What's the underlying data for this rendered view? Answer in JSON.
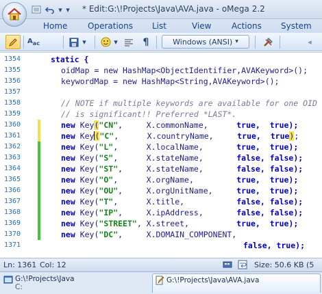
{
  "window": {
    "title": "* Edit:G:\\!Projects\\Java\\AVA.java - oMega 2.2"
  },
  "ribbon_tabs": [
    "Home",
    "Operations",
    "List",
    "View",
    "Actions",
    "System"
  ],
  "toolbar": {
    "encoding_label": "Windows (ANSI)"
  },
  "editor": {
    "lines": [
      {
        "num": "1354",
        "marked": false
      },
      {
        "num": "1355",
        "marked": false
      },
      {
        "num": "1356",
        "marked": false
      },
      {
        "num": "1357",
        "marked": false
      },
      {
        "num": "1358",
        "marked": false
      },
      {
        "num": "1359",
        "marked": false
      },
      {
        "num": "1360",
        "marked": "yellow"
      },
      {
        "num": "1361",
        "marked": "yellow"
      },
      {
        "num": "1362",
        "marked": "green"
      },
      {
        "num": "1363",
        "marked": "green"
      },
      {
        "num": "1364",
        "marked": "green"
      },
      {
        "num": "1365",
        "marked": "green"
      },
      {
        "num": "1366",
        "marked": "green"
      },
      {
        "num": "1367",
        "marked": "green"
      },
      {
        "num": "1368",
        "marked": "green"
      },
      {
        "num": "1369",
        "marked": "green"
      },
      {
        "num": "1370",
        "marked": "green"
      },
      {
        "num": "1371",
        "marked": false
      }
    ],
    "code": {
      "l1354": "static {",
      "l1355": "oidMap = new HashMap<ObjectIdentifier,AVAKeyword>();",
      "l1356": "keywordMap = new HashMap<String,AVAKeyword>();",
      "l1358": "// NOTE if multiple keywords are available for one OID",
      "l1359": "// is significant!! Preferred *LAST*.",
      "keys": [
        {
          "str": "\"CN\"",
          "field": "X.commonName,",
          "b1": "true,",
          "b2": "true);"
        },
        {
          "str": "\"C\"",
          "field": "X.countryName,",
          "b1": "true,",
          "b2": "true);"
        },
        {
          "str": "\"L\"",
          "field": "X.localName,",
          "b1": "true,",
          "b2": "true);"
        },
        {
          "str": "\"S\"",
          "field": "X.stateName,",
          "b1": "false,",
          "b2": "false);"
        },
        {
          "str": "\"ST\"",
          "field": "X.stateName,",
          "b1": "false,",
          "b2": "false);"
        },
        {
          "str": "\"O\"",
          "field": "X.orgName,",
          "b1": "true,",
          "b2": "true);"
        },
        {
          "str": "\"OU\"",
          "field": "X.orgUnitName,",
          "b1": "true,",
          "b2": "true);"
        },
        {
          "str": "\"T\"",
          "field": "X.title,",
          "b1": "false,",
          "b2": "false);"
        },
        {
          "str": "\"IP\"",
          "field": "X.ipAddress,",
          "b1": "false,",
          "b2": "false);"
        },
        {
          "str": "\"STREET\"",
          "field": "X.street,",
          "b1": "true,",
          "b2": "true);"
        },
        {
          "str": "\"DC\"",
          "field": "X.DOMAIN_COMPONENT,",
          "b1": "",
          "b2": ""
        }
      ],
      "l1371": "false, true);"
    }
  },
  "status": {
    "line": "Ln: 1361",
    "col": "Col: 12",
    "size": "Size: 50.6 KB (5"
  },
  "doc_tabs": [
    {
      "path": "G:\\!Projects\\Java",
      "sub": "C:"
    },
    {
      "path": "G:\\!Projects\\Java\\AVA.java"
    }
  ],
  "colors": {
    "keyword": "#0000cc",
    "string": "#14851a",
    "line_number": "#2b6cb1",
    "mark_yellow": "#f2e04a",
    "mark_green": "#49c43a"
  }
}
